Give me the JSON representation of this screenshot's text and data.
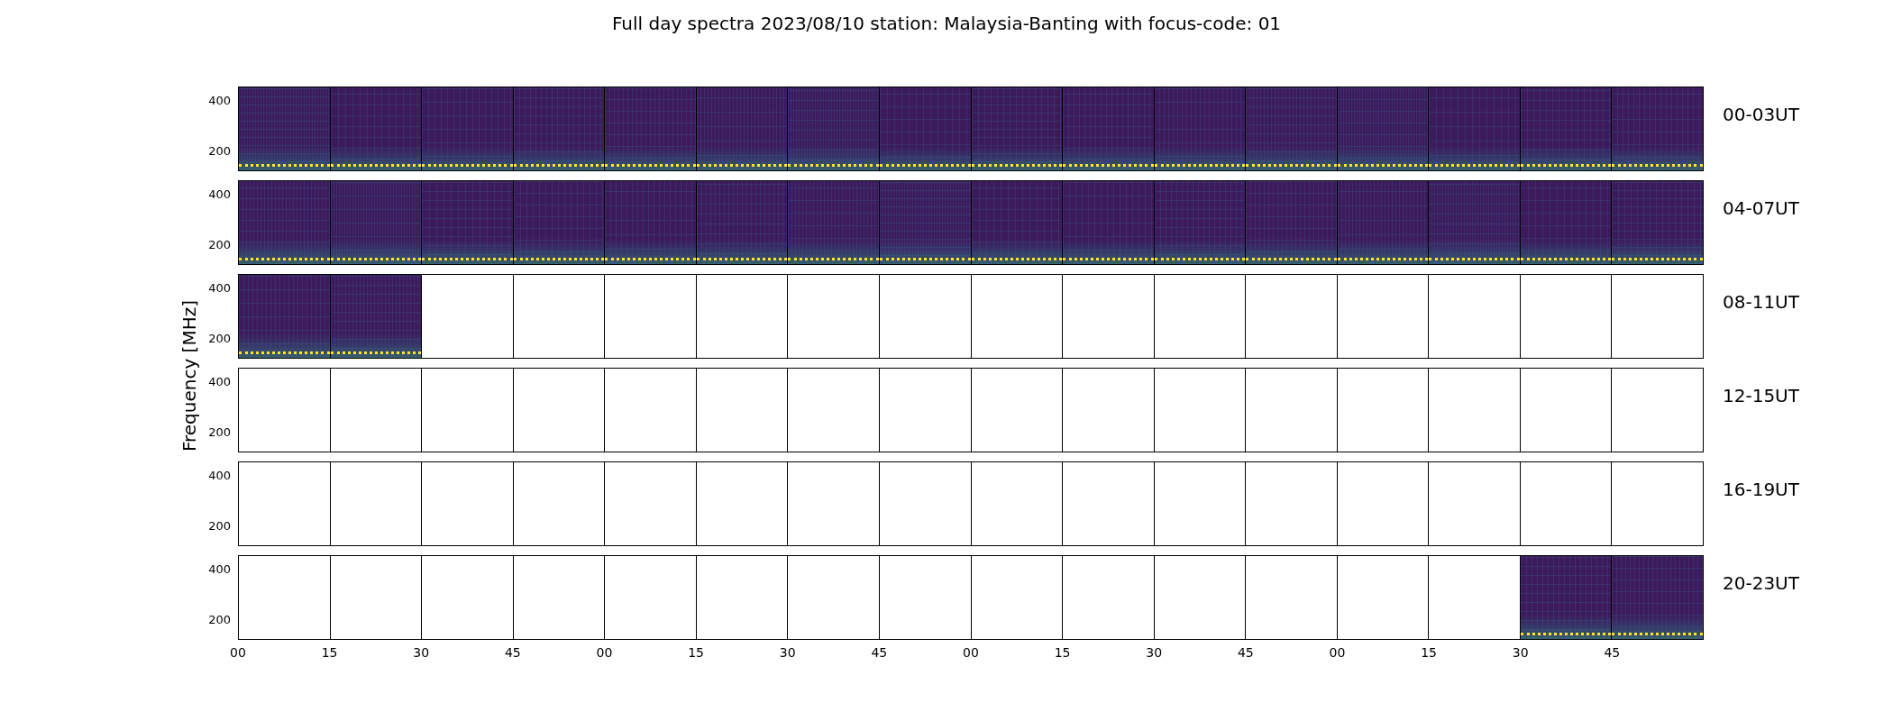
{
  "title": "Full day spectra 2023/08/10 station: Malaysia-Banting with focus-code: 01",
  "ylabel": "Frequency [MHz]",
  "xticks": [
    "00",
    "15",
    "30",
    "45",
    "00",
    "15",
    "30",
    "45",
    "00",
    "15",
    "30",
    "45",
    "00",
    "15",
    "30",
    "45"
  ],
  "rows": [
    {
      "label": "00-03UT",
      "yticks": [
        "400",
        "200"
      ],
      "panels": [
        {
          "has_data": true
        },
        {
          "has_data": true
        },
        {
          "has_data": true
        },
        {
          "has_data": true
        },
        {
          "has_data": true
        },
        {
          "has_data": true
        },
        {
          "has_data": true
        },
        {
          "has_data": true
        },
        {
          "has_data": true
        },
        {
          "has_data": true
        },
        {
          "has_data": true
        },
        {
          "has_data": true
        },
        {
          "has_data": true
        },
        {
          "has_data": true
        },
        {
          "has_data": true
        },
        {
          "has_data": true
        }
      ]
    },
    {
      "label": "04-07UT",
      "yticks": [
        "400",
        "200"
      ],
      "panels": [
        {
          "has_data": true
        },
        {
          "has_data": true
        },
        {
          "has_data": true
        },
        {
          "has_data": true
        },
        {
          "has_data": true
        },
        {
          "has_data": true
        },
        {
          "has_data": true
        },
        {
          "has_data": true
        },
        {
          "has_data": true
        },
        {
          "has_data": true
        },
        {
          "has_data": true
        },
        {
          "has_data": true
        },
        {
          "has_data": true
        },
        {
          "has_data": true
        },
        {
          "has_data": true
        },
        {
          "has_data": true
        }
      ]
    },
    {
      "label": "08-11UT",
      "yticks": [
        "400",
        "200"
      ],
      "panels": [
        {
          "has_data": true
        },
        {
          "has_data": true
        },
        {
          "has_data": false
        },
        {
          "has_data": false
        },
        {
          "has_data": false
        },
        {
          "has_data": false
        },
        {
          "has_data": false
        },
        {
          "has_data": false
        },
        {
          "has_data": false
        },
        {
          "has_data": false
        },
        {
          "has_data": false
        },
        {
          "has_data": false
        },
        {
          "has_data": false
        },
        {
          "has_data": false
        },
        {
          "has_data": false
        },
        {
          "has_data": false
        }
      ]
    },
    {
      "label": "12-15UT",
      "yticks": [
        "400",
        "200"
      ],
      "panels": [
        {
          "has_data": false
        },
        {
          "has_data": false
        },
        {
          "has_data": false
        },
        {
          "has_data": false
        },
        {
          "has_data": false
        },
        {
          "has_data": false
        },
        {
          "has_data": false
        },
        {
          "has_data": false
        },
        {
          "has_data": false
        },
        {
          "has_data": false
        },
        {
          "has_data": false
        },
        {
          "has_data": false
        },
        {
          "has_data": false
        },
        {
          "has_data": false
        },
        {
          "has_data": false
        },
        {
          "has_data": false
        }
      ]
    },
    {
      "label": "16-19UT",
      "yticks": [
        "400",
        "200"
      ],
      "panels": [
        {
          "has_data": false
        },
        {
          "has_data": false
        },
        {
          "has_data": false
        },
        {
          "has_data": false
        },
        {
          "has_data": false
        },
        {
          "has_data": false
        },
        {
          "has_data": false
        },
        {
          "has_data": false
        },
        {
          "has_data": false
        },
        {
          "has_data": false
        },
        {
          "has_data": false
        },
        {
          "has_data": false
        },
        {
          "has_data": false
        },
        {
          "has_data": false
        },
        {
          "has_data": false
        },
        {
          "has_data": false
        }
      ]
    },
    {
      "label": "20-23UT",
      "yticks": [
        "400",
        "200"
      ],
      "panels": [
        {
          "has_data": false
        },
        {
          "has_data": false
        },
        {
          "has_data": false
        },
        {
          "has_data": false
        },
        {
          "has_data": false
        },
        {
          "has_data": false
        },
        {
          "has_data": false
        },
        {
          "has_data": false
        },
        {
          "has_data": false
        },
        {
          "has_data": false
        },
        {
          "has_data": false
        },
        {
          "has_data": false
        },
        {
          "has_data": false
        },
        {
          "has_data": false
        },
        {
          "has_data": true
        },
        {
          "has_data": true
        }
      ]
    }
  ]
}
